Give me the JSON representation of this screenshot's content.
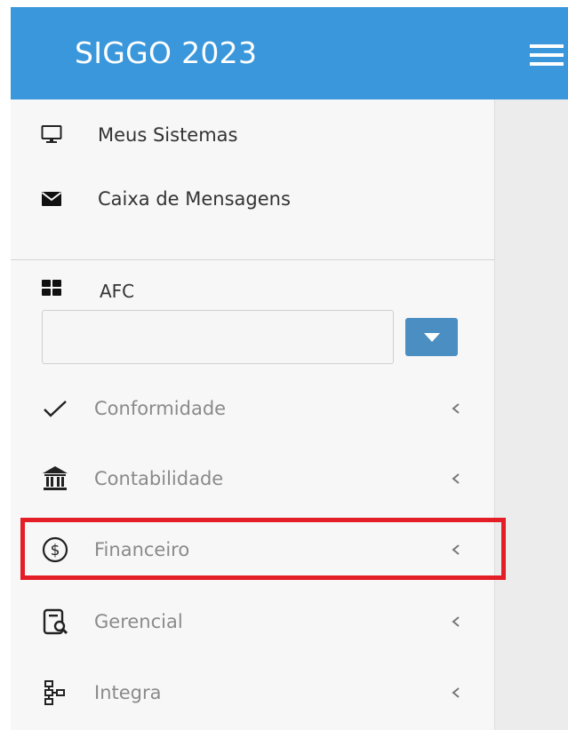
{
  "header": {
    "title": "SIGGO 2023",
    "menu_icon": "hamburger-icon"
  },
  "sidebar": {
    "top_items": [
      {
        "label": "Meus Sistemas",
        "icon": "monitor-icon"
      },
      {
        "label": "Caixa de Mensagens",
        "icon": "envelope-icon"
      }
    ],
    "section": {
      "label": "AFC",
      "icon": "grid-icon",
      "select_value": "",
      "dropdown_icon": "caret-down-icon"
    },
    "nav_items": [
      {
        "label": "Conformidade",
        "icon": "check-icon"
      },
      {
        "label": "Contabilidade",
        "icon": "bank-icon"
      },
      {
        "label": "Financeiro",
        "icon": "dollar-circle-icon"
      },
      {
        "label": "Gerencial",
        "icon": "report-search-icon"
      },
      {
        "label": "Integra",
        "icon": "hierarchy-icon"
      }
    ]
  },
  "colors": {
    "header_bg": "#3a97db",
    "sidebar_bg": "#f7f7f7",
    "dropdown_button": "#4a8ec2",
    "highlight_border": "#e41e26",
    "nav_text": "#8a8a8a"
  }
}
